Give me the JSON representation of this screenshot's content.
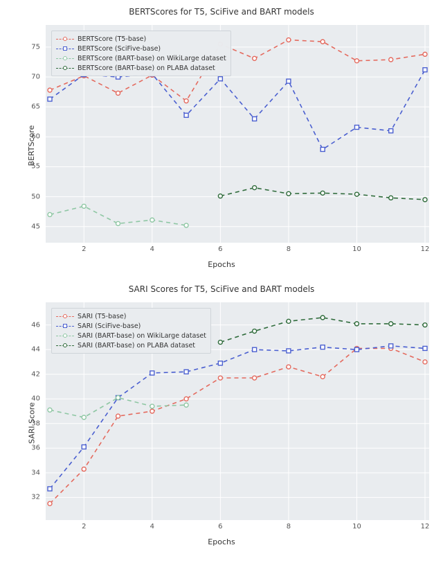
{
  "chart_data": [
    {
      "type": "line",
      "title": "BERTScores for T5, SciFive and BART models",
      "xlabel": "Epochs",
      "ylabel": "BERTScore",
      "x": [
        1,
        2,
        3,
        4,
        5,
        6,
        7,
        8,
        9,
        10,
        11,
        12
      ],
      "xticks": [
        2,
        4,
        6,
        8,
        10,
        12
      ],
      "yticks": [
        45,
        50,
        55,
        60,
        65,
        70,
        75
      ],
      "ylim": [
        43,
        78
      ],
      "series": [
        {
          "name": "BERTScore (T5-base)",
          "color": "#e46a5e",
          "marker": "circle",
          "values": [
            67.8,
            70.2,
            67.3,
            70.3,
            66.0,
            75.5,
            73.1,
            76.2,
            75.9,
            72.7,
            72.9,
            73.8
          ]
        },
        {
          "name": "BERTScore (SciFive-base)",
          "color": "#4a5fd0",
          "marker": "square",
          "values": [
            66.3,
            70.4,
            70.0,
            70.5,
            63.6,
            69.7,
            63.0,
            69.3,
            57.9,
            61.6,
            61.0,
            71.2
          ]
        },
        {
          "name": "BERTScore (BART-base) on WikiLarge dataset",
          "color": "#8fc7a4",
          "marker": "circle",
          "values": [
            47.0,
            48.4,
            45.5,
            46.1,
            45.2,
            null,
            null,
            null,
            null,
            null,
            null,
            null
          ]
        },
        {
          "name": "BERTScore (BART-base) on PLABA dataset",
          "color": "#2f6b3b",
          "marker": "circle",
          "values": [
            null,
            null,
            null,
            null,
            null,
            50.1,
            51.5,
            50.5,
            50.6,
            50.4,
            49.8,
            49.5
          ]
        }
      ],
      "legend_pos": "upper-left"
    },
    {
      "type": "line",
      "title": "SARI Scores for T5, SciFive and BART models",
      "xlabel": "Epochs",
      "ylabel": "SARI Score",
      "x": [
        1,
        2,
        3,
        4,
        5,
        6,
        7,
        8,
        9,
        10,
        11,
        12
      ],
      "xticks": [
        2,
        4,
        6,
        8,
        10,
        12
      ],
      "yticks": [
        32,
        34,
        36,
        38,
        40,
        42,
        44,
        46
      ],
      "ylim": [
        30.5,
        47.5
      ],
      "series": [
        {
          "name": "SARI (T5-base)",
          "color": "#e46a5e",
          "marker": "circle",
          "values": [
            31.5,
            34.3,
            38.6,
            39.0,
            40.0,
            41.7,
            41.7,
            42.6,
            41.8,
            44.1,
            44.1,
            43.0
          ]
        },
        {
          "name": "SARI (SciFive-base)",
          "color": "#4a5fd0",
          "marker": "square",
          "values": [
            32.7,
            36.1,
            40.1,
            42.1,
            42.2,
            42.9,
            44.0,
            43.9,
            44.2,
            44.0,
            44.3,
            44.1
          ]
        },
        {
          "name": "SARI (BART-base) on WikiLarge dataset",
          "color": "#8fc7a4",
          "marker": "circle",
          "values": [
            39.1,
            38.5,
            40.1,
            39.4,
            39.5,
            null,
            null,
            null,
            null,
            null,
            null,
            null
          ]
        },
        {
          "name": "SARI (BART-base) on PLABA dataset",
          "color": "#2f6b3b",
          "marker": "circle",
          "values": [
            null,
            null,
            null,
            null,
            null,
            44.6,
            45.5,
            46.3,
            46.6,
            46.1,
            46.1,
            46.0
          ]
        }
      ],
      "legend_pos": "upper-left"
    }
  ]
}
